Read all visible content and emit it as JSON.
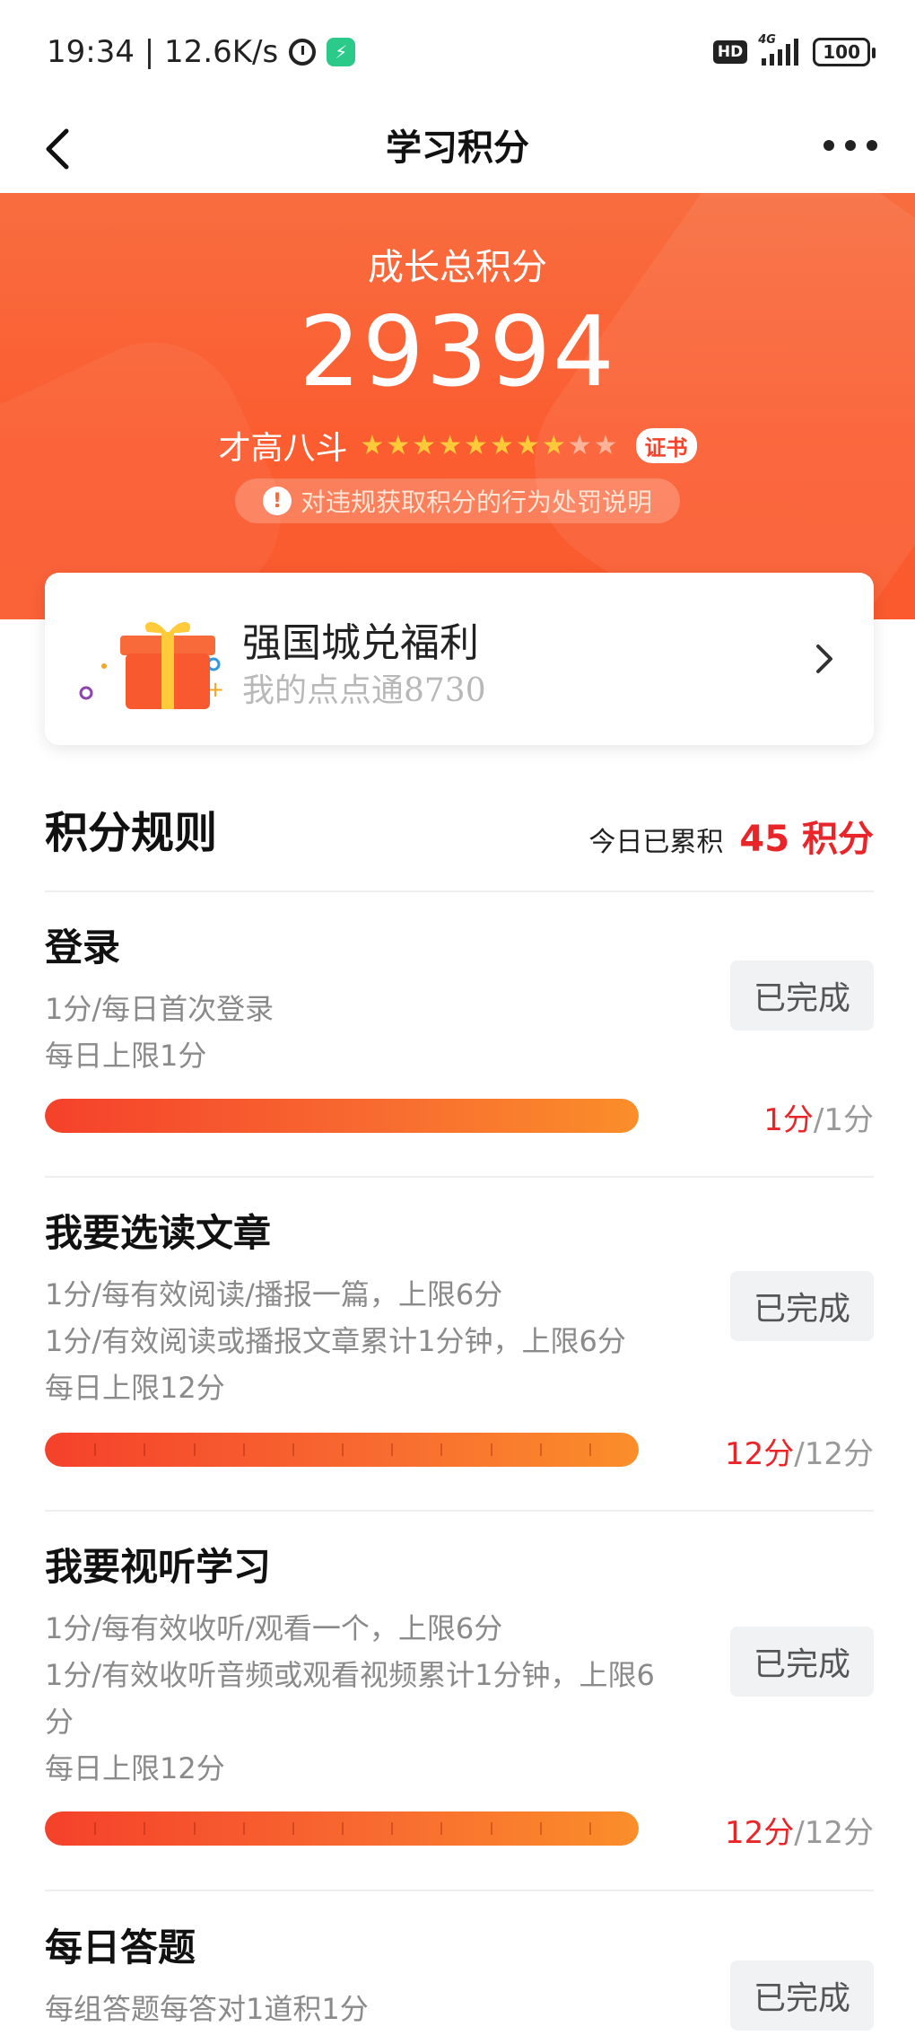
{
  "status_bar": {
    "time_speed": "19:34 | 12.6K/s",
    "hd": "HD",
    "network": "4G",
    "battery": "100"
  },
  "nav": {
    "title": "学习积分"
  },
  "hero": {
    "label": "成长总积分",
    "score": "29394",
    "level_name": "才高八斗",
    "stars_total": 10,
    "stars_filled": 8,
    "cert_label": "证书",
    "violation_text": "对违规获取积分的行为处罚说明"
  },
  "welfare": {
    "title": "强国城兑福利",
    "subtitle": "我的点点通8730"
  },
  "rules": {
    "title": "积分规则",
    "today_label": "今日已累积",
    "today_value": "45 积分",
    "items": [
      {
        "title": "登录",
        "desc": [
          "1分/每日首次登录",
          "每日上限1分"
        ],
        "button": "已完成",
        "current": "1分",
        "total": "/1分",
        "progress": 1.0,
        "segments": 1
      },
      {
        "title": "我要选读文章",
        "desc": [
          "1分/每有效阅读/播报一篇，上限6分",
          "1分/有效阅读或播报文章累计1分钟，上限6分",
          "每日上限12分"
        ],
        "button": "已完成",
        "current": "12分",
        "total": "/12分",
        "progress": 1.0,
        "segments": 12
      },
      {
        "title": "我要视听学习",
        "desc": [
          "1分/每有效收听/观看一个，上限6分",
          "1分/有效收听音频或观看视频累计1分钟，上限6",
          "分",
          "每日上限12分"
        ],
        "button": "已完成",
        "current": "12分",
        "total": "/12分",
        "progress": 1.0,
        "segments": 12
      },
      {
        "title": "每日答题",
        "desc": [
          "每组答题每答对1道积1分"
        ],
        "button": "已完成"
      }
    ]
  }
}
